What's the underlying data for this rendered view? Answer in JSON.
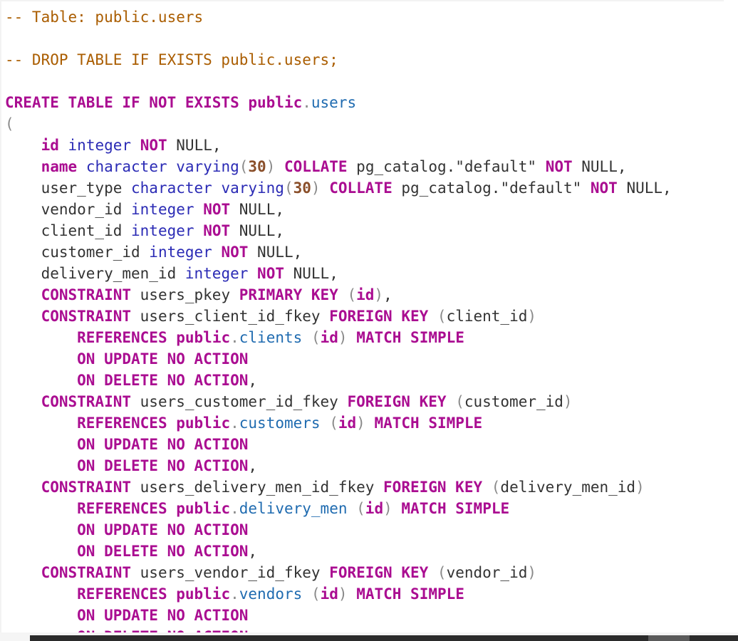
{
  "editor": {
    "lines": [
      [
        {
          "t": "-- Table: public.users",
          "c": "cm"
        }
      ],
      [],
      [
        {
          "t": "-- DROP TABLE IF EXISTS public.users;",
          "c": "cm"
        }
      ],
      [],
      [
        {
          "t": "CREATE TABLE IF NOT EXISTS ",
          "c": "kw"
        },
        {
          "t": "public",
          "c": "kw"
        },
        {
          "t": ".",
          "c": "pun"
        },
        {
          "t": "users",
          "c": "tbl"
        }
      ],
      [
        {
          "t": "(",
          "c": "pun"
        }
      ],
      [
        {
          "t": "    "
        },
        {
          "t": "id",
          "c": "kw"
        },
        {
          "t": " "
        },
        {
          "t": "integer",
          "c": "ty"
        },
        {
          "t": " "
        },
        {
          "t": "NOT",
          "c": "kw"
        },
        {
          "t": " NULL,"
        }
      ],
      [
        {
          "t": "    "
        },
        {
          "t": "name",
          "c": "kw"
        },
        {
          "t": " "
        },
        {
          "t": "character varying",
          "c": "ty"
        },
        {
          "t": "(",
          "c": "pun"
        },
        {
          "t": "30",
          "c": "num"
        },
        {
          "t": ")",
          "c": "pun"
        },
        {
          "t": " "
        },
        {
          "t": "COLLATE",
          "c": "kw"
        },
        {
          "t": " pg_catalog.\"default\" "
        },
        {
          "t": "NOT",
          "c": "kw"
        },
        {
          "t": " NULL,"
        }
      ],
      [
        {
          "t": "    user_type "
        },
        {
          "t": "character varying",
          "c": "ty"
        },
        {
          "t": "(",
          "c": "pun"
        },
        {
          "t": "30",
          "c": "num"
        },
        {
          "t": ")",
          "c": "pun"
        },
        {
          "t": " "
        },
        {
          "t": "COLLATE",
          "c": "kw"
        },
        {
          "t": " pg_catalog.\"default\" "
        },
        {
          "t": "NOT",
          "c": "kw"
        },
        {
          "t": " NULL,"
        }
      ],
      [
        {
          "t": "    vendor_id "
        },
        {
          "t": "integer",
          "c": "ty"
        },
        {
          "t": " "
        },
        {
          "t": "NOT",
          "c": "kw"
        },
        {
          "t": " NULL,"
        }
      ],
      [
        {
          "t": "    client_id "
        },
        {
          "t": "integer",
          "c": "ty"
        },
        {
          "t": " "
        },
        {
          "t": "NOT",
          "c": "kw"
        },
        {
          "t": " NULL,"
        }
      ],
      [
        {
          "t": "    customer_id "
        },
        {
          "t": "integer",
          "c": "ty"
        },
        {
          "t": " "
        },
        {
          "t": "NOT",
          "c": "kw"
        },
        {
          "t": " NULL,"
        }
      ],
      [
        {
          "t": "    delivery_men_id "
        },
        {
          "t": "integer",
          "c": "ty"
        },
        {
          "t": " "
        },
        {
          "t": "NOT",
          "c": "kw"
        },
        {
          "t": " NULL,"
        }
      ],
      [
        {
          "t": "    "
        },
        {
          "t": "CONSTRAINT",
          "c": "kw"
        },
        {
          "t": " users_pkey "
        },
        {
          "t": "PRIMARY KEY",
          "c": "kw"
        },
        {
          "t": " "
        },
        {
          "t": "(",
          "c": "pun"
        },
        {
          "t": "id",
          "c": "kw"
        },
        {
          "t": ")",
          "c": "pun"
        },
        {
          "t": ","
        }
      ],
      [
        {
          "t": "    "
        },
        {
          "t": "CONSTRAINT",
          "c": "kw"
        },
        {
          "t": " users_client_id_fkey "
        },
        {
          "t": "FOREIGN KEY",
          "c": "kw"
        },
        {
          "t": " "
        },
        {
          "t": "(",
          "c": "pun"
        },
        {
          "t": "client_id"
        },
        {
          "t": ")",
          "c": "pun"
        }
      ],
      [
        {
          "t": "        "
        },
        {
          "t": "REFERENCES",
          "c": "kw"
        },
        {
          "t": " "
        },
        {
          "t": "public",
          "c": "kw"
        },
        {
          "t": ".",
          "c": "pun"
        },
        {
          "t": "clients",
          "c": "tbl"
        },
        {
          "t": " "
        },
        {
          "t": "(",
          "c": "pun"
        },
        {
          "t": "id",
          "c": "kw"
        },
        {
          "t": ")",
          "c": "pun"
        },
        {
          "t": " "
        },
        {
          "t": "MATCH SIMPLE",
          "c": "kw"
        }
      ],
      [
        {
          "t": "        "
        },
        {
          "t": "ON UPDATE NO ACTION",
          "c": "kw"
        }
      ],
      [
        {
          "t": "        "
        },
        {
          "t": "ON DELETE NO ACTION",
          "c": "kw"
        },
        {
          "t": ","
        }
      ],
      [
        {
          "t": "    "
        },
        {
          "t": "CONSTRAINT",
          "c": "kw"
        },
        {
          "t": " users_customer_id_fkey "
        },
        {
          "t": "FOREIGN KEY",
          "c": "kw"
        },
        {
          "t": " "
        },
        {
          "t": "(",
          "c": "pun"
        },
        {
          "t": "customer_id"
        },
        {
          "t": ")",
          "c": "pun"
        }
      ],
      [
        {
          "t": "        "
        },
        {
          "t": "REFERENCES",
          "c": "kw"
        },
        {
          "t": " "
        },
        {
          "t": "public",
          "c": "kw"
        },
        {
          "t": ".",
          "c": "pun"
        },
        {
          "t": "customers",
          "c": "tbl"
        },
        {
          "t": " "
        },
        {
          "t": "(",
          "c": "pun"
        },
        {
          "t": "id",
          "c": "kw"
        },
        {
          "t": ")",
          "c": "pun"
        },
        {
          "t": " "
        },
        {
          "t": "MATCH SIMPLE",
          "c": "kw"
        }
      ],
      [
        {
          "t": "        "
        },
        {
          "t": "ON UPDATE NO ACTION",
          "c": "kw"
        }
      ],
      [
        {
          "t": "        "
        },
        {
          "t": "ON DELETE NO ACTION",
          "c": "kw"
        },
        {
          "t": ","
        }
      ],
      [
        {
          "t": "    "
        },
        {
          "t": "CONSTRAINT",
          "c": "kw"
        },
        {
          "t": " users_delivery_men_id_fkey "
        },
        {
          "t": "FOREIGN KEY",
          "c": "kw"
        },
        {
          "t": " "
        },
        {
          "t": "(",
          "c": "pun"
        },
        {
          "t": "delivery_men_id"
        },
        {
          "t": ")",
          "c": "pun"
        }
      ],
      [
        {
          "t": "        "
        },
        {
          "t": "REFERENCES",
          "c": "kw"
        },
        {
          "t": " "
        },
        {
          "t": "public",
          "c": "kw"
        },
        {
          "t": ".",
          "c": "pun"
        },
        {
          "t": "delivery_men",
          "c": "tbl"
        },
        {
          "t": " "
        },
        {
          "t": "(",
          "c": "pun"
        },
        {
          "t": "id",
          "c": "kw"
        },
        {
          "t": ")",
          "c": "pun"
        },
        {
          "t": " "
        },
        {
          "t": "MATCH SIMPLE",
          "c": "kw"
        }
      ],
      [
        {
          "t": "        "
        },
        {
          "t": "ON UPDATE NO ACTION",
          "c": "kw"
        }
      ],
      [
        {
          "t": "        "
        },
        {
          "t": "ON DELETE NO ACTION",
          "c": "kw"
        },
        {
          "t": ","
        }
      ],
      [
        {
          "t": "    "
        },
        {
          "t": "CONSTRAINT",
          "c": "kw"
        },
        {
          "t": " users_vendor_id_fkey "
        },
        {
          "t": "FOREIGN KEY",
          "c": "kw"
        },
        {
          "t": " "
        },
        {
          "t": "(",
          "c": "pun"
        },
        {
          "t": "vendor_id"
        },
        {
          "t": ")",
          "c": "pun"
        }
      ],
      [
        {
          "t": "        "
        },
        {
          "t": "REFERENCES",
          "c": "kw"
        },
        {
          "t": " "
        },
        {
          "t": "public",
          "c": "kw"
        },
        {
          "t": ".",
          "c": "pun"
        },
        {
          "t": "vendors",
          "c": "tbl"
        },
        {
          "t": " "
        },
        {
          "t": "(",
          "c": "pun"
        },
        {
          "t": "id",
          "c": "kw"
        },
        {
          "t": ")",
          "c": "pun"
        },
        {
          "t": " "
        },
        {
          "t": "MATCH SIMPLE",
          "c": "kw"
        }
      ],
      [
        {
          "t": "        "
        },
        {
          "t": "ON UPDATE NO ACTION",
          "c": "kw"
        }
      ],
      [
        {
          "t": "        "
        },
        {
          "t": "ON DELETE NO ACTION",
          "c": "kw"
        }
      ]
    ]
  },
  "colors": {
    "keyword": "#aa0d91",
    "type": "#2b2bb5",
    "comment": "#aa5d00",
    "table_name": "#1f6bb0",
    "number": "#8a4f2a",
    "punctuation": "#8a8a8a",
    "text": "#333333",
    "background": "#ffffff"
  }
}
